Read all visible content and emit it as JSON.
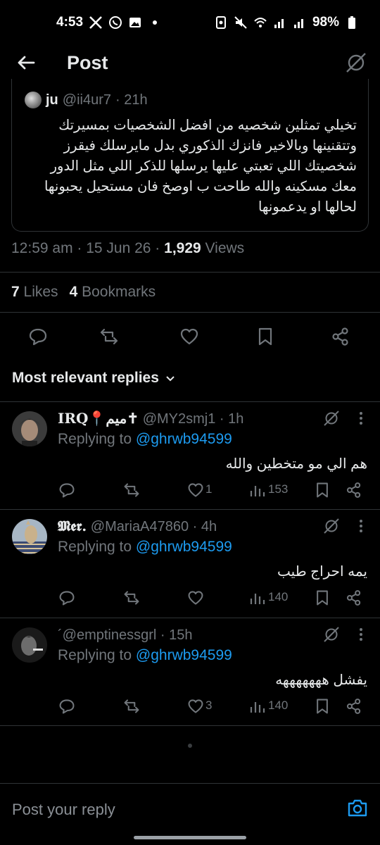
{
  "status_bar": {
    "time": "4:53",
    "battery": "98%"
  },
  "header": {
    "title": "Post"
  },
  "quoted": {
    "name": "ju",
    "handle": "@ii4ur7",
    "time": "· 21h",
    "text": "تخيلي تمثلين شخصيه من افضل الشخصيات بمسيرتك وتتقنينها وبالاخير فانزك الذكوري بدل مايرسلك فيقرز شخصيتك اللي تعبتي عليها يرسلها للذكر اللي مثل الدور معك مسكينه والله طاحت ب اوصخ فان مستحيل يحبونها لحالها او يدعمونها"
  },
  "meta": {
    "time": "12:59 am · 15 Jun 26 · ",
    "views_count": "1,929",
    "views_label": " Views"
  },
  "stats": {
    "likes_count": "7",
    "likes_label": "Likes",
    "bookmarks_count": "4",
    "bookmarks_label": "Bookmarks"
  },
  "sort": {
    "label": "Most relevant replies"
  },
  "replies": [
    {
      "name": "IRQ📍ميم✝",
      "handle": "@MY2smj1",
      "time": "· 1h",
      "replying_prefix": "Replying to ",
      "replying_to": "@ghrwb94599",
      "text": "هم الي مو متخطين والله",
      "likes": "1",
      "views": "153"
    },
    {
      "name": "𝕸𝖊𝖗.",
      "handle": "@MariaA47860",
      "time": "· 4h",
      "replying_prefix": "Replying to ",
      "replying_to": "@ghrwb94599",
      "text": "يمه احراج طيب",
      "likes": "",
      "views": "140"
    },
    {
      "name": "",
      "handle": "´@emptinessgrl",
      "time": "· 15h",
      "replying_prefix": "Replying to ",
      "replying_to": "@ghrwb94599",
      "text": "يفشل هههههههه",
      "likes": "3",
      "views": "140"
    }
  ],
  "composer": {
    "placeholder": "Post your reply"
  }
}
